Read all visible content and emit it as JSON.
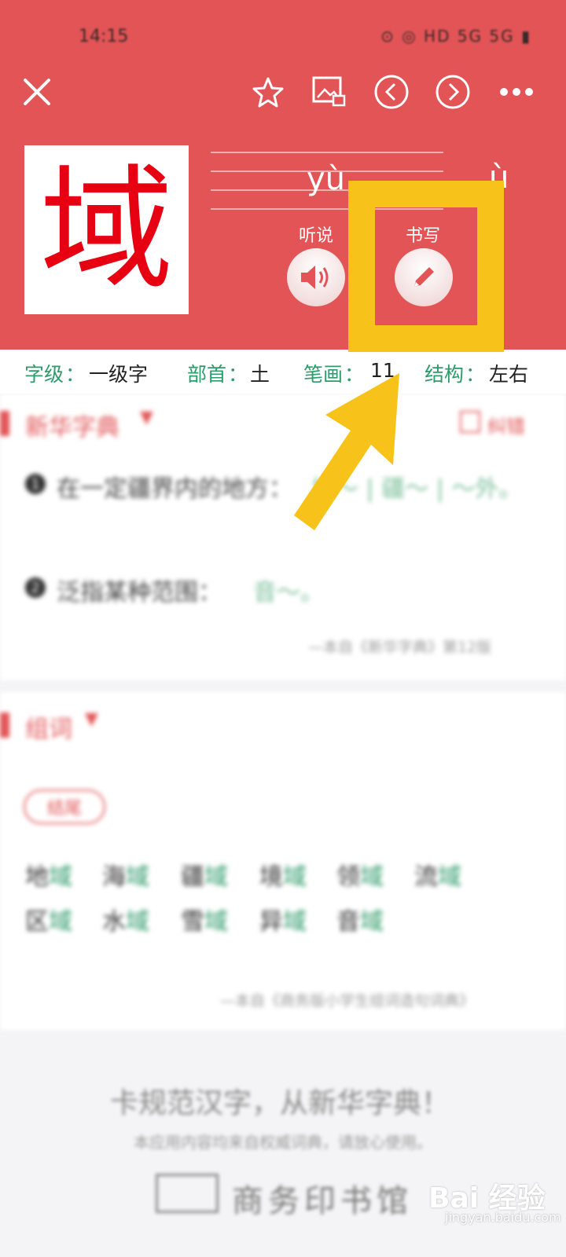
{
  "status_bar": {
    "time": "14:15",
    "indicators": "⊙ ◎ HD 5G 5G ▮"
  },
  "toolbar": {
    "close_icon": "close-icon",
    "star_icon": "star-icon",
    "image_icon": "image-icon",
    "prev_icon": "prev-icon",
    "next_icon": "next-icon",
    "more_icon": "more-icon"
  },
  "character": {
    "glyph": "域",
    "pinyin": "yù",
    "pinyin_secondary": "ù"
  },
  "actions": {
    "listen_label": "听说",
    "write_label": "书写"
  },
  "info": {
    "level_key": "字级",
    "level_value": "一级字",
    "radical_key": "部首",
    "radical_value": "土",
    "strokes_key": "笔画",
    "strokes_value": "11",
    "structure_key": "结构",
    "structure_value": "左右"
  },
  "xinhua": {
    "title": "新华字典",
    "error_label": "纠错",
    "definitions": [
      {
        "num": "1",
        "text": "在一定疆界内的地方：",
        "examples": "地～ | 疆～ | ～外。"
      },
      {
        "num": "2",
        "text": "泛指某种范围：",
        "examples": "音～。"
      }
    ],
    "source": "—本自《新华字典》第12版"
  },
  "zuci": {
    "title": "组词",
    "tag": "结尾",
    "words_row1": [
      {
        "a": "地",
        "b": "域"
      },
      {
        "a": "海",
        "b": "域"
      },
      {
        "a": "疆",
        "b": "域"
      },
      {
        "a": "境",
        "b": "域"
      },
      {
        "a": "领",
        "b": "域"
      },
      {
        "a": "流",
        "b": "域"
      }
    ],
    "words_row2": [
      {
        "a": "区",
        "b": "域"
      },
      {
        "a": "水",
        "b": "域"
      },
      {
        "a": "雪",
        "b": "域"
      },
      {
        "a": "异",
        "b": "域"
      },
      {
        "a": "音",
        "b": "域"
      }
    ],
    "source": "—本自《商务版小学生组词造句词典》"
  },
  "footer": {
    "slogan": "卡规范汉字，从新华字典！",
    "sub": "本应用内容均来自权威词典，请放心使用。",
    "brand": "商务印书馆"
  },
  "watermark": {
    "text": "Bai 经验",
    "sub": "jingyan.baidu.com"
  },
  "colors": {
    "header_red": "#e25456",
    "char_red": "#e60012",
    "green": "#2e9b6a",
    "highlight_yellow": "#f7c31a"
  }
}
